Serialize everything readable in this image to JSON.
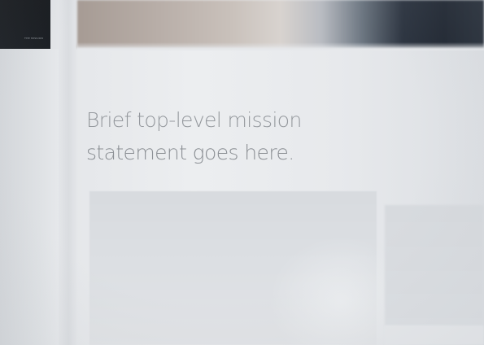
{
  "nav": {
    "tagline": "THE MISSION"
  },
  "hero": {
    "mission_line1": "Brief top-level mission",
    "mission_line2": "statement goes here."
  },
  "colors": {
    "nav_bg": "#16191d",
    "page_bg": "#e4e6e9",
    "mission_text": "#8d9196",
    "card_bg": "#d8dbdf"
  }
}
